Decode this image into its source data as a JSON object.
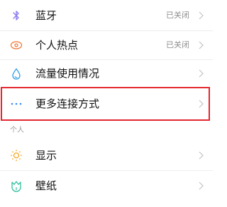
{
  "settings": {
    "items": [
      {
        "label": "蓝牙",
        "status": "已关闭",
        "icon": "bluetooth-icon"
      },
      {
        "label": "个人热点",
        "status": "已关闭",
        "icon": "hotspot-icon"
      },
      {
        "label": "流量使用情况",
        "status": "",
        "icon": "data-usage-icon"
      },
      {
        "label": "更多连接方式",
        "status": "",
        "icon": "more-connections-icon"
      }
    ],
    "section_personal": "个人",
    "personal_items": [
      {
        "label": "显示",
        "icon": "display-icon"
      },
      {
        "label": "壁纸",
        "icon": "wallpaper-icon"
      }
    ]
  },
  "colors": {
    "highlight": "#e3262e",
    "bluetooth_icon": "#8b7cf0",
    "hotspot_icon": "#f07a3a",
    "data_usage_icon": "#2f9de4",
    "more_icon": "#3b8cf5",
    "display_icon": "#f5a623",
    "wallpaper_icon": "#2fbf9f"
  }
}
